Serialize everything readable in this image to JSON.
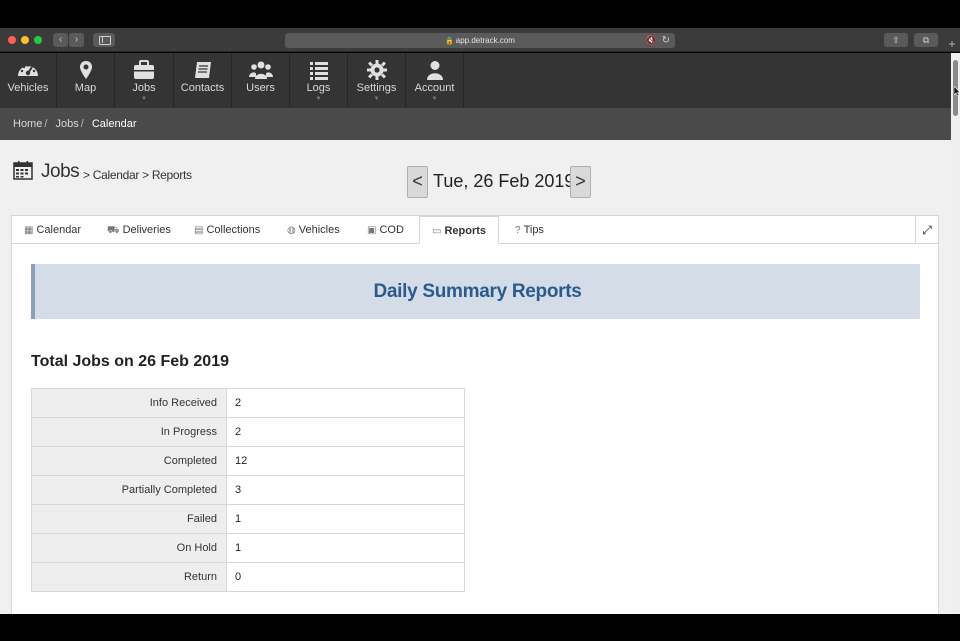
{
  "browser": {
    "url": "app.detrack.com"
  },
  "nav": {
    "items": [
      {
        "label": "Vehicles",
        "icon": "dashboard-icon"
      },
      {
        "label": "Map",
        "icon": "map-pin-icon"
      },
      {
        "label": "Jobs",
        "icon": "briefcase-icon"
      },
      {
        "label": "Contacts",
        "icon": "address-book-icon"
      },
      {
        "label": "Users",
        "icon": "users-icon"
      },
      {
        "label": "Logs",
        "icon": "list-icon"
      },
      {
        "label": "Settings",
        "icon": "gear-icon"
      },
      {
        "label": "Account",
        "icon": "user-icon"
      }
    ]
  },
  "breadcrumb": {
    "home": "Home",
    "jobs": "Jobs",
    "current": "Calendar"
  },
  "page": {
    "title": "Jobs",
    "subtitle": "> Calendar > Reports",
    "date": "Tue, 26 Feb 2019",
    "prev": "<",
    "next": ">"
  },
  "tabs": [
    {
      "label": "Calendar",
      "icon": "calendar-icon"
    },
    {
      "label": "Deliveries",
      "icon": "truck-icon"
    },
    {
      "label": "Collections",
      "icon": "archive-icon"
    },
    {
      "label": "Vehicles",
      "icon": "car-icon"
    },
    {
      "label": "COD",
      "icon": "money-icon"
    },
    {
      "label": "Reports",
      "icon": "desktop-icon",
      "active": true
    },
    {
      "label": "Tips",
      "icon": "question-circle-icon"
    }
  ],
  "report": {
    "banner_title": "Daily Summary Reports",
    "totals_heading": "Total Jobs on 26 Feb 2019",
    "rows": [
      {
        "label": "Info Received",
        "value": "2"
      },
      {
        "label": "In Progress",
        "value": "2"
      },
      {
        "label": "Completed",
        "value": "12"
      },
      {
        "label": "Partially Completed",
        "value": "3"
      },
      {
        "label": "Failed",
        "value": "1"
      },
      {
        "label": "On Hold",
        "value": "1"
      },
      {
        "label": "Return",
        "value": "0"
      }
    ]
  },
  "colors": {
    "nav_bg": "#343434",
    "breadcrumb_bg": "#4a4a4a",
    "banner_bg": "#d3dce7",
    "banner_text": "#2b5b8c"
  }
}
